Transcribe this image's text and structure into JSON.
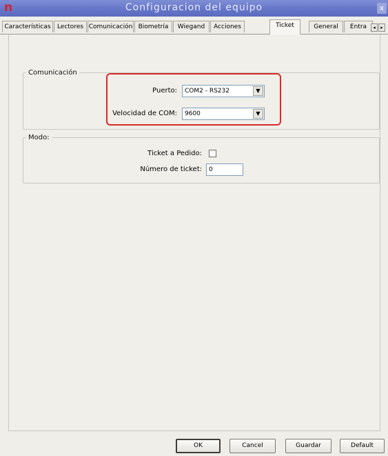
{
  "window": {
    "title": "Configuracion del equipo",
    "app_icon": "n",
    "close_glyph": "x"
  },
  "tabs": [
    {
      "label": "Características"
    },
    {
      "label": "Lectores"
    },
    {
      "label": "Comunicación"
    },
    {
      "label": "Biometría"
    },
    {
      "label": "Wiegand"
    },
    {
      "label": "Acciones"
    },
    {
      "label": "Ticket"
    },
    {
      "label": "General"
    },
    {
      "label": "Entra"
    }
  ],
  "active_tab": "Ticket",
  "tab_scroll": {
    "left": "◂",
    "right": "▸"
  },
  "comunicacion": {
    "legend": "Comunicación",
    "puerto_label": "Puerto:",
    "puerto_value": "COM2 - RS232",
    "velocidad_label": "Velocidad de COM:",
    "velocidad_value": "9600"
  },
  "modo": {
    "legend": "Modo:",
    "ticket_pedido_label": "Ticket a Pedido:",
    "ticket_pedido_checked": false,
    "numero_ticket_label": "Número de ticket:",
    "numero_ticket_value": "0"
  },
  "combo_arrow": "▼",
  "buttons": {
    "ok": "OK",
    "cancel": "Cancel",
    "guardar": "Guardar",
    "default": "Default"
  },
  "colors": {
    "title_bar": "#6676c8",
    "highlight": "#d72a2a",
    "app_icon": "#d2232a"
  }
}
